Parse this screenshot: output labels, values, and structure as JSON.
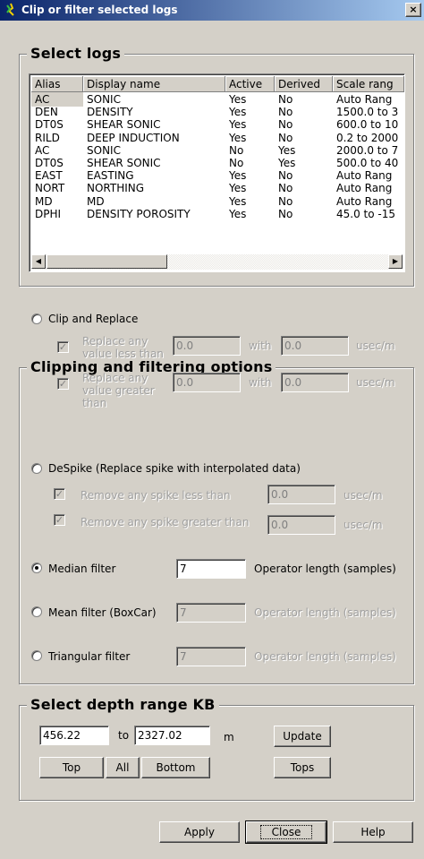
{
  "window": {
    "title": "Clip or filter selected logs",
    "close_label": "×"
  },
  "select_logs": {
    "legend": "Select logs",
    "columns": [
      "Alias",
      "Display name",
      "Active",
      "Derived",
      "Scale rang"
    ],
    "rows": [
      {
        "alias": "AC",
        "name": "SONIC",
        "active": "Yes",
        "derived": "No",
        "scale": "Auto Rang"
      },
      {
        "alias": "DEN",
        "name": "DENSITY",
        "active": "Yes",
        "derived": "No",
        "scale": "1500.0 to 3"
      },
      {
        "alias": "DT0S",
        "name": "SHEAR SONIC",
        "active": "Yes",
        "derived": "No",
        "scale": "600.0 to 10"
      },
      {
        "alias": "RILD",
        "name": "DEEP INDUCTION",
        "active": "Yes",
        "derived": "No",
        "scale": "0.2 to 2000"
      },
      {
        "alias": "AC",
        "name": "SONIC",
        "active": "No",
        "derived": "Yes",
        "scale": "2000.0 to 7"
      },
      {
        "alias": "DT0S",
        "name": "SHEAR SONIC",
        "active": "No",
        "derived": "Yes",
        "scale": "500.0 to 40"
      },
      {
        "alias": "EAST",
        "name": "EASTING",
        "active": "Yes",
        "derived": "No",
        "scale": "Auto Rang"
      },
      {
        "alias": "NORT",
        "name": "NORTHING",
        "active": "Yes",
        "derived": "No",
        "scale": "Auto Rang"
      },
      {
        "alias": "MD",
        "name": "MD",
        "active": "Yes",
        "derived": "No",
        "scale": "Auto Rang"
      },
      {
        "alias": "DPHI",
        "name": "DENSITY POROSITY",
        "active": "Yes",
        "derived": "No",
        "scale": "45.0 to -15"
      }
    ]
  },
  "options": {
    "legend": "Clipping and filtering options",
    "clip_replace": {
      "label": "Clip and Replace",
      "less_label": "Replace any value less than",
      "less_value": "0.0",
      "less_with": "0.0",
      "greater_label": "Replace any value greater than",
      "greater_value": "0.0",
      "greater_with": "0.0",
      "with_label": "with",
      "unit": "usec/m"
    },
    "despike": {
      "label": "DeSpike (Replace spike with interpolated data)",
      "less_label": "Remove any spike less than",
      "less_value": "0.0",
      "greater_label": "Remove any spike greater than",
      "greater_value": "0.0",
      "unit": "usec/m"
    },
    "median": {
      "label": "Median filter",
      "value": "7",
      "suffix": "Operator length (samples)",
      "selected": true
    },
    "mean": {
      "label": "Mean filter (BoxCar)",
      "value": "7",
      "suffix": "Operator length (samples)"
    },
    "triangular": {
      "label": "Triangular filter",
      "value": "7",
      "suffix": "Operator length (samples)"
    }
  },
  "depth": {
    "legend": "Select depth range KB",
    "from": "456.22",
    "to_label": "to",
    "to": "2327.02",
    "unit": "m",
    "update": "Update",
    "top": "Top",
    "all": "All",
    "bottom": "Bottom",
    "tops": "Tops"
  },
  "footer": {
    "apply": "Apply",
    "close": "Close",
    "help": "Help"
  }
}
